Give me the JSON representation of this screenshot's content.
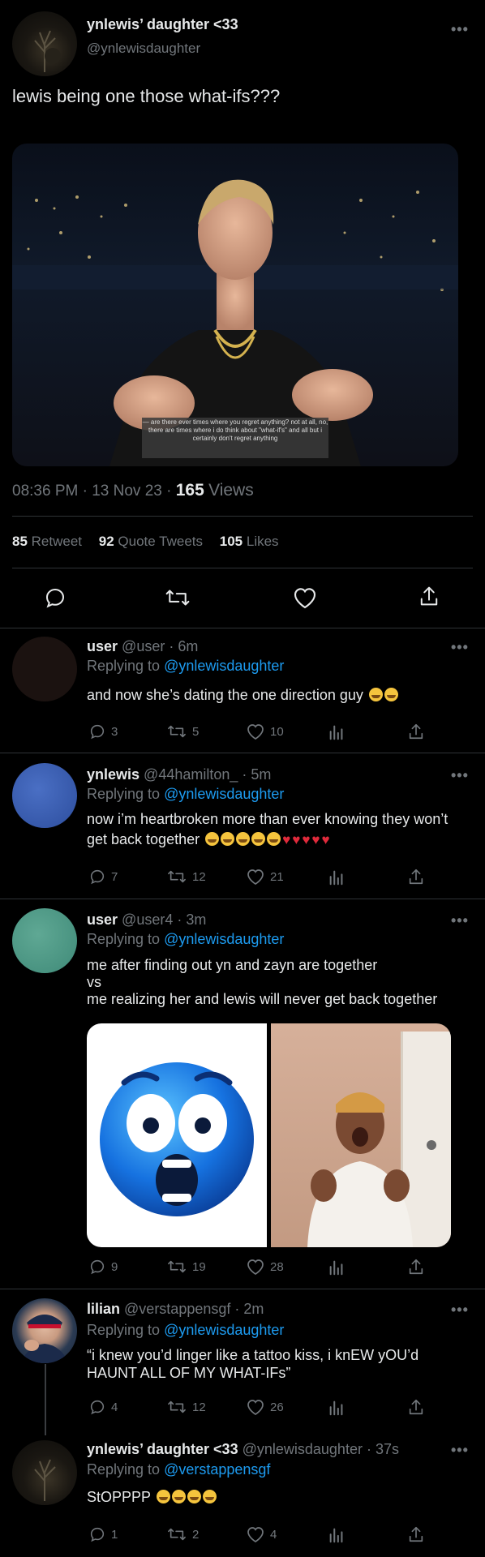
{
  "tweet": {
    "author_name": "ynlewis’ daughter <33",
    "author_handle": "@ynlewisdaughter",
    "text": "lewis being one those what-ifs???",
    "media": {
      "caption": "— are there ever times where you regret anything? not at all, no, there are times where i do think about \"what-if's\" and all but i certainly don't regret anything"
    },
    "time": "08:36 PM",
    "date": "13 Nov 23",
    "views_count": "165",
    "views_label": "Views",
    "retweets_count": "85",
    "retweets_label": "Retweet",
    "quotes_count": "92",
    "quotes_label": "Quote Tweets",
    "likes_count": "105",
    "likes_label": "Likes"
  },
  "replies": [
    {
      "name": "user",
      "handle": "@user",
      "time": "6m",
      "replying_label": "Replying to",
      "replying_to": "@ynlewisdaughter",
      "text": "and now she’s dating the one direction guy",
      "reply_count": "3",
      "retweet_count": "5",
      "like_count": "10"
    },
    {
      "name": "ynlewis",
      "handle": "@44hamilton_",
      "time": "5m",
      "replying_label": "Replying to",
      "replying_to": "@ynlewisdaughter",
      "text_line1": "now i’m heartbroken more than ever knowing they won’t",
      "text_line2": "get back together",
      "reply_count": "7",
      "retweet_count": "12",
      "like_count": "21"
    },
    {
      "name": "user",
      "handle": "@user4",
      "time": "3m",
      "replying_label": "Replying to",
      "replying_to": "@ynlewisdaughter",
      "text_line1": "me after finding out yn and zayn are together",
      "text_line2": "vs",
      "text_line3": "me realizing her and lewis will never get back together",
      "reply_count": "9",
      "retweet_count": "19",
      "like_count": "28"
    },
    {
      "name": "lilian",
      "handle": "@verstappensgf",
      "time": "2m",
      "replying_label": "Replying to",
      "replying_to": "@ynlewisdaughter",
      "text_line1": "“i knew you’d linger like a tattoo kiss, i knEW yOU’d",
      "text_line2": "HAUNT ALL OF MY WHAT-IFs”",
      "reply_count": "4",
      "retweet_count": "12",
      "like_count": "26"
    },
    {
      "name": "ynlewis’ daughter <33",
      "handle": "@ynlewisdaughter",
      "time": "37s",
      "replying_label": "Replying to",
      "replying_to": "@verstappensgf",
      "text": "StOPPPP",
      "reply_count": "1",
      "retweet_count": "2",
      "like_count": "4"
    }
  ],
  "colors": {
    "background": "#000000",
    "text": "#e7e9ea",
    "muted": "#71767b",
    "link": "#1d9bf0",
    "divider": "#2f3336"
  }
}
